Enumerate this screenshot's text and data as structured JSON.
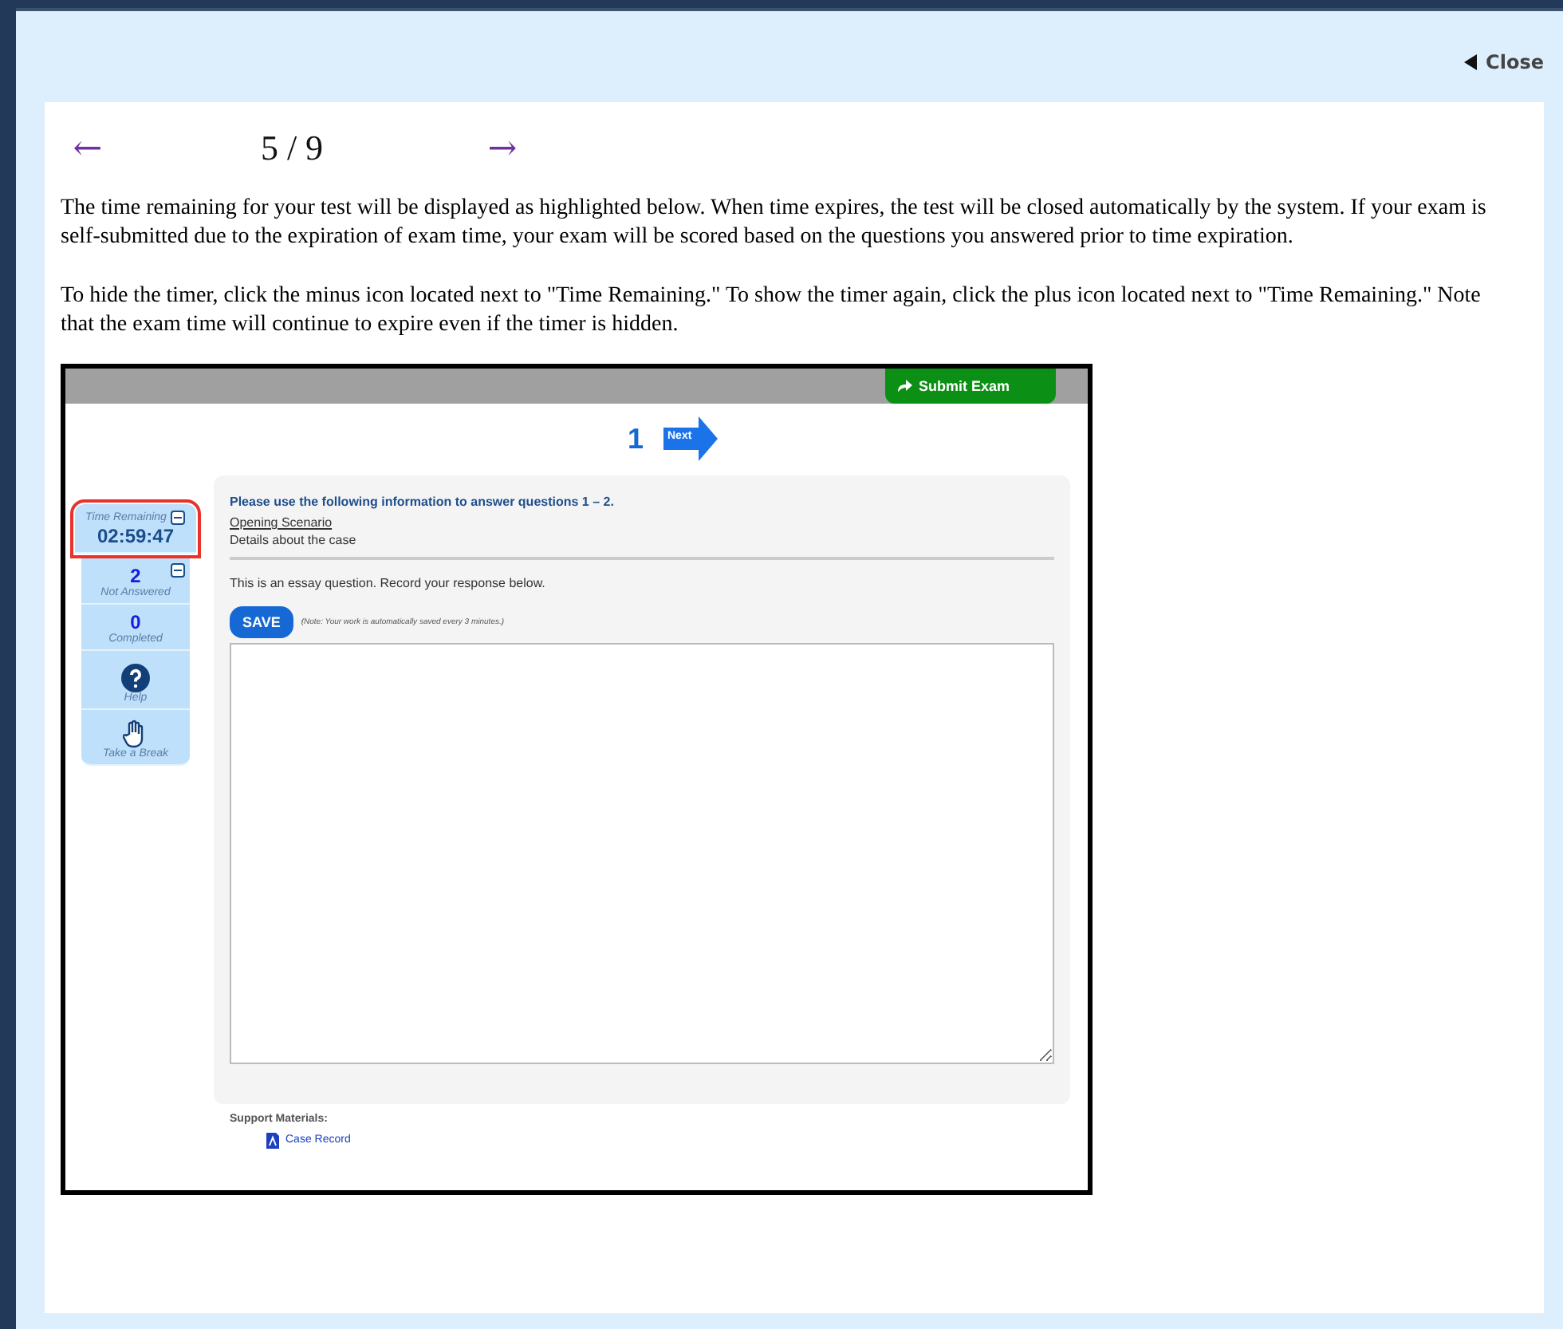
{
  "dialog": {
    "close": "Close"
  },
  "pager": {
    "prev": "←",
    "position": "5 / 9",
    "next": "→"
  },
  "paragraphs": [
    "The time remaining for your test will be displayed as highlighted below. When time expires, the test will be closed automatically by the system. If your exam is self-submitted due to the expiration of exam time, your exam will be scored based on the questions you answered prior to time expiration.",
    "To hide the timer, click the minus icon located next to \"Time Remaining.\" To show the timer again, click the plus icon located next to \"Time Remaining.\" Note that the exam time will continue to expire even if the timer is hidden."
  ],
  "screenshot": {
    "submit": "Submit Exam",
    "question_number": "1",
    "next": "Next",
    "sidebar": [
      {
        "kind": "timer",
        "label": "Time Remaining",
        "value": "02:59:47",
        "highlighted": true,
        "toggle": true
      },
      {
        "kind": "count",
        "value": "2",
        "label": "Not Answered",
        "toggle": true
      },
      {
        "kind": "count",
        "value": "0",
        "label": "Completed",
        "toggle": false
      },
      {
        "kind": "help",
        "label": "Help"
      },
      {
        "kind": "break",
        "label": "Take a Break"
      }
    ],
    "intro": "Please use the following information to answer questions 1 – 2.",
    "scenario_link": "Opening Scenario",
    "details": "Details about the case",
    "prompt": "This is an essay question. Record your response below.",
    "save": "SAVE",
    "save_note": "(Note: Your work is automatically saved every 3 minutes.)",
    "support_title": "Support Materials:",
    "materials": [
      "Case Record"
    ]
  }
}
